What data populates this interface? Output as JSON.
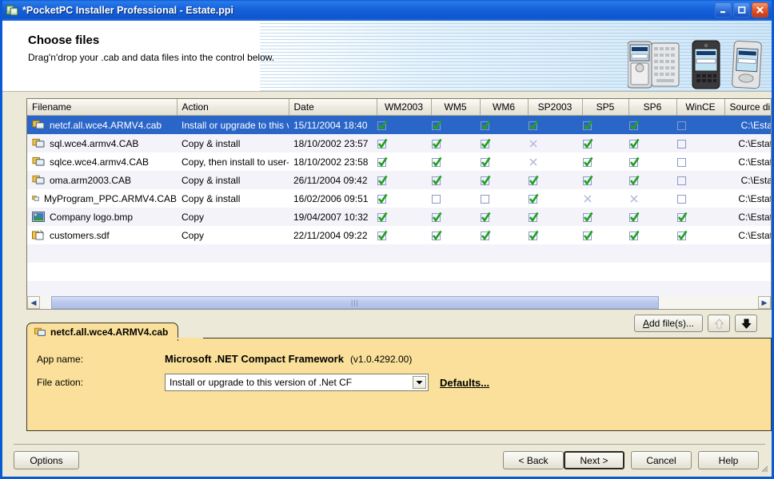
{
  "window": {
    "title": "*PocketPC Installer Professional - Estate.ppi",
    "app_icon": "pocketpc-installer-icon",
    "controls": {
      "minimize": "minimize",
      "maximize": "maximize",
      "close": "close"
    }
  },
  "banner": {
    "title": "Choose files",
    "subtitle": "Drag'n'drop your .cab and data files into the control below.",
    "devices": [
      "device-qwerty-phone",
      "device-black-pda",
      "device-silver-pda"
    ]
  },
  "file_list": {
    "columns": [
      "Filename",
      "Action",
      "Date",
      "WM2003",
      "WM5",
      "WM6",
      "SP2003",
      "SP5",
      "SP6",
      "WinCE",
      "Source dir"
    ],
    "rows": [
      {
        "icon": "cab-file-icon",
        "filename": "netcf.all.wce4.ARMV4.cab",
        "action": "Install or upgrade to this v...",
        "date": "15/11/2004  18:40",
        "flags": [
          "check",
          "check",
          "check",
          "check",
          "check",
          "check",
          "empty"
        ],
        "source": "C:\\Estate",
        "selected": true
      },
      {
        "icon": "cab-file-icon",
        "filename": "sql.wce4.armv4.CAB",
        "action": "Copy & install",
        "date": "18/10/2002  23:57",
        "flags": [
          "check",
          "check",
          "check",
          "cross",
          "check",
          "check",
          "empty"
        ],
        "source": "C:\\Estate.",
        "selected": false
      },
      {
        "icon": "cab-file-icon",
        "filename": "sqlce.wce4.armv4.CAB",
        "action": "Copy, then install to user-...",
        "date": "18/10/2002  23:58",
        "flags": [
          "check",
          "check",
          "check",
          "cross",
          "check",
          "check",
          "empty"
        ],
        "source": "C:\\Estate.",
        "selected": false
      },
      {
        "icon": "cab-file-icon",
        "filename": "oma.arm2003.CAB",
        "action": "Copy & install",
        "date": "26/11/2004  09:42",
        "flags": [
          "check",
          "check",
          "check",
          "check",
          "check",
          "check",
          "empty"
        ],
        "source": "C:\\Estate",
        "selected": false
      },
      {
        "icon": "cab-file-icon",
        "filename": "MyProgram_PPC.ARMV4.CAB",
        "action": "Copy & install",
        "date": "16/02/2006  09:51",
        "flags": [
          "check",
          "empty",
          "empty",
          "check",
          "cross",
          "cross",
          "empty"
        ],
        "source": "C:\\Estate.",
        "selected": false
      },
      {
        "icon": "bitmap-file-icon",
        "filename": "Company logo.bmp",
        "action": "Copy",
        "date": "19/04/2007  10:32",
        "flags": [
          "check",
          "check",
          "check",
          "check",
          "check",
          "check",
          "check"
        ],
        "source": "C:\\Estate.",
        "selected": false
      },
      {
        "icon": "sdf-file-icon",
        "filename": "customers.sdf",
        "action": "Copy",
        "date": "22/11/2004  09:22",
        "flags": [
          "check",
          "check",
          "check",
          "check",
          "check",
          "check",
          "check"
        ],
        "source": "C:\\Estate.",
        "selected": false
      }
    ],
    "empty_rows": 3
  },
  "toolbar": {
    "add_files_label": "Add file(s)...",
    "add_files_accel": "A",
    "move_up": "move-up-arrow",
    "move_down": "move-down-arrow"
  },
  "detail": {
    "tab_title": "netcf.all.wce4.ARMV4.cab",
    "tab_icon": "cab-file-icon",
    "app_name_label": "App name:",
    "app_name_value": "Microsoft .NET Compact Framework",
    "app_version": "(v1.0.4292.00)",
    "file_action_label": "File action:",
    "file_action_value": "Install or upgrade to this version of .Net CF",
    "defaults_link": "Defaults..."
  },
  "footer": {
    "options": "Options",
    "back": "< Back",
    "next": "Next >",
    "cancel": "Cancel",
    "help": "Help"
  },
  "colors": {
    "titlebar_blue": "#0A5BD3",
    "selection_blue": "#2A66C8",
    "panel_yellow": "#FAE09A",
    "dialog_beige": "#ECE9D8",
    "check_green": "#21A021"
  }
}
